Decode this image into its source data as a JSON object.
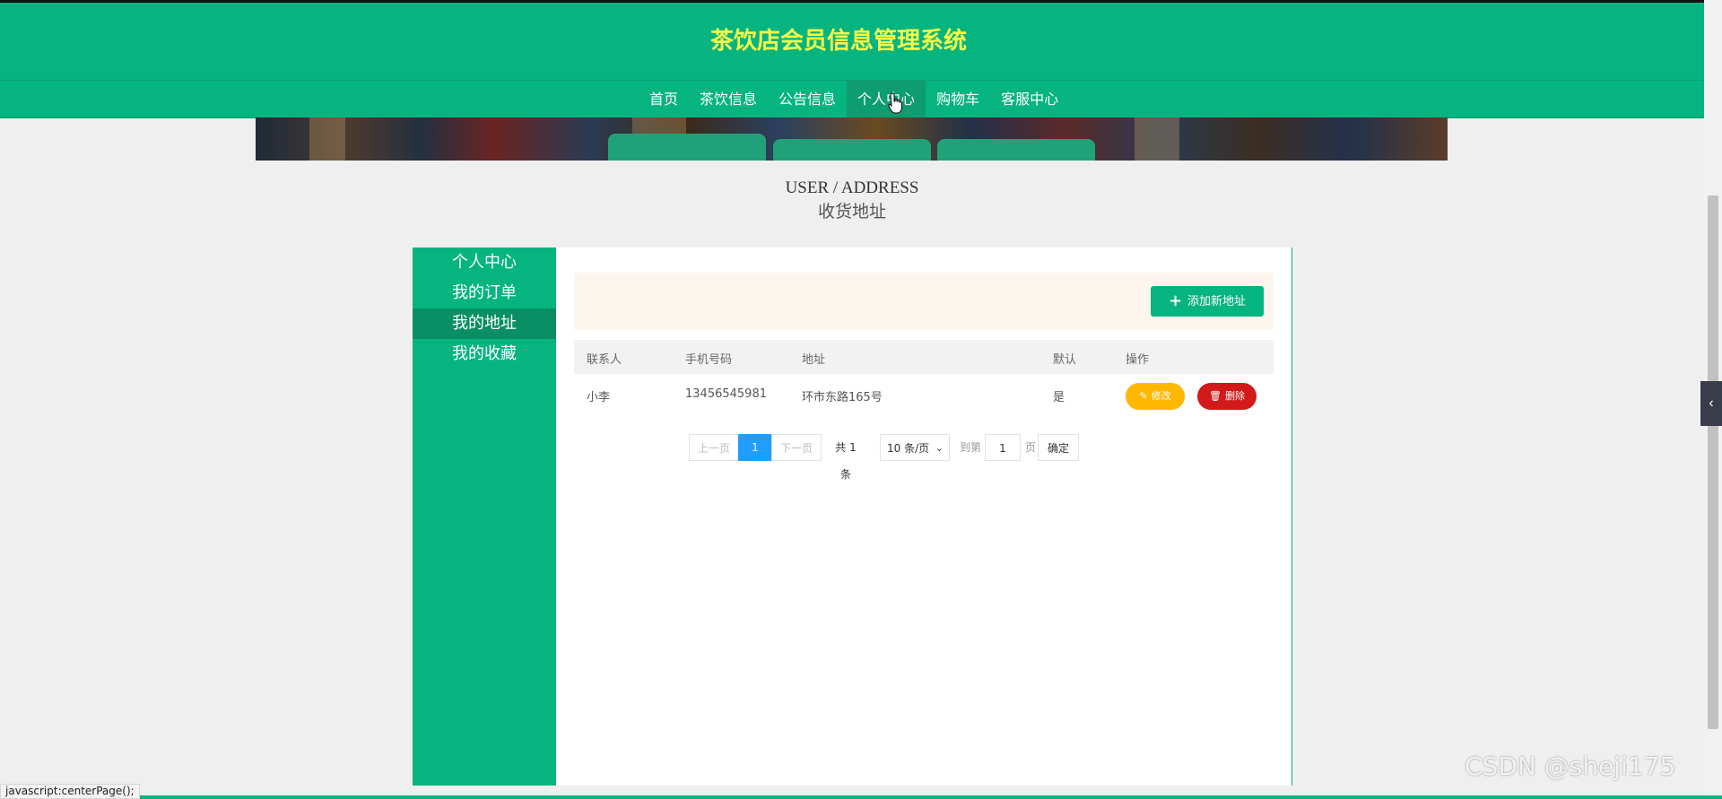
{
  "site": {
    "title": "茶饮店会员信息管理系统"
  },
  "nav": {
    "items": [
      "首页",
      "茶饮信息",
      "公告信息",
      "个人中心",
      "购物车",
      "客服中心"
    ],
    "active_index": 3
  },
  "section": {
    "title_en": "USER / ADDRESS",
    "title_cn": "收货地址"
  },
  "sidebar": {
    "items": [
      "个人中心",
      "我的订单",
      "我的地址",
      "我的收藏"
    ],
    "active_index": 2
  },
  "toolbar": {
    "add_label": "添加新地址"
  },
  "table": {
    "columns": [
      "联系人",
      "手机号码",
      "地址",
      "默认",
      "操作"
    ],
    "rows": [
      {
        "contact": "小李",
        "phone": "13456545981",
        "address": "环市东路165号",
        "default": "是",
        "edit_label": "修改",
        "delete_label": "删除"
      }
    ]
  },
  "pagination": {
    "prev": "上一页",
    "current": "1",
    "next": "下一页",
    "total": "共 1 条",
    "page_size": "10 条/页",
    "goto_label": "到第",
    "goto_value": "1",
    "page_unit": "页",
    "confirm": "确定"
  },
  "status_bar": {
    "text": "javascript:centerPage();"
  },
  "watermark": "CSDN @sheji175",
  "colors": {
    "primary": "#06b47f",
    "title": "#f3f94a",
    "edit": "#ffb800",
    "delete": "#d21a1a",
    "page_active": "#1e9fff"
  }
}
